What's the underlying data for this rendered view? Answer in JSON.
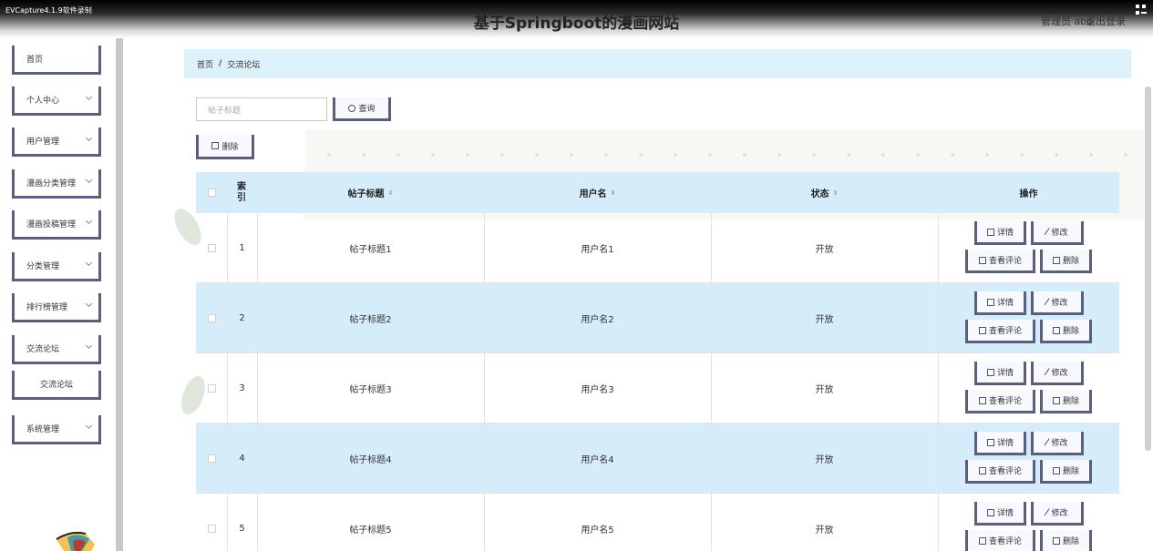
{
  "capture_label": "EVCapture4.1.9软件录制",
  "site_title": "基于Springboot的漫画网站",
  "user": {
    "info": "管理员 abo",
    "logout": "退出登录"
  },
  "sidebar": {
    "items": [
      {
        "label": "首页"
      },
      {
        "label": "个人中心"
      },
      {
        "label": "用户管理"
      },
      {
        "label": "漫画分类管理"
      },
      {
        "label": "漫画投稿管理"
      },
      {
        "label": "分类管理"
      },
      {
        "label": "排行榜管理"
      },
      {
        "label": "交流论坛"
      },
      {
        "label": "交流论坛"
      },
      {
        "label": "系统管理"
      }
    ]
  },
  "breadcrumb": {
    "home": "首页",
    "separator": "/",
    "current": "交流论坛"
  },
  "search": {
    "placeholder": "帖子标题",
    "button": "查询"
  },
  "toolbar": {
    "delete": "删除"
  },
  "table": {
    "headers": {
      "index": "索引",
      "title": "帖子标题",
      "username": "用户名",
      "status": "状态",
      "actions": "操作"
    },
    "rows": [
      {
        "index": "1",
        "title": "帖子标题1",
        "username": "用户名1",
        "status": "开放"
      },
      {
        "index": "2",
        "title": "帖子标题2",
        "username": "用户名2",
        "status": "开放"
      },
      {
        "index": "3",
        "title": "帖子标题3",
        "username": "用户名3",
        "status": "开放"
      },
      {
        "index": "4",
        "title": "帖子标题4",
        "username": "用户名4",
        "status": "开放"
      },
      {
        "index": "5",
        "title": "帖子标题5",
        "username": "用户名5",
        "status": "开放"
      }
    ],
    "actions": {
      "detail": "详情",
      "edit": "修改",
      "comments": "查看评论",
      "delete": "删除"
    }
  }
}
